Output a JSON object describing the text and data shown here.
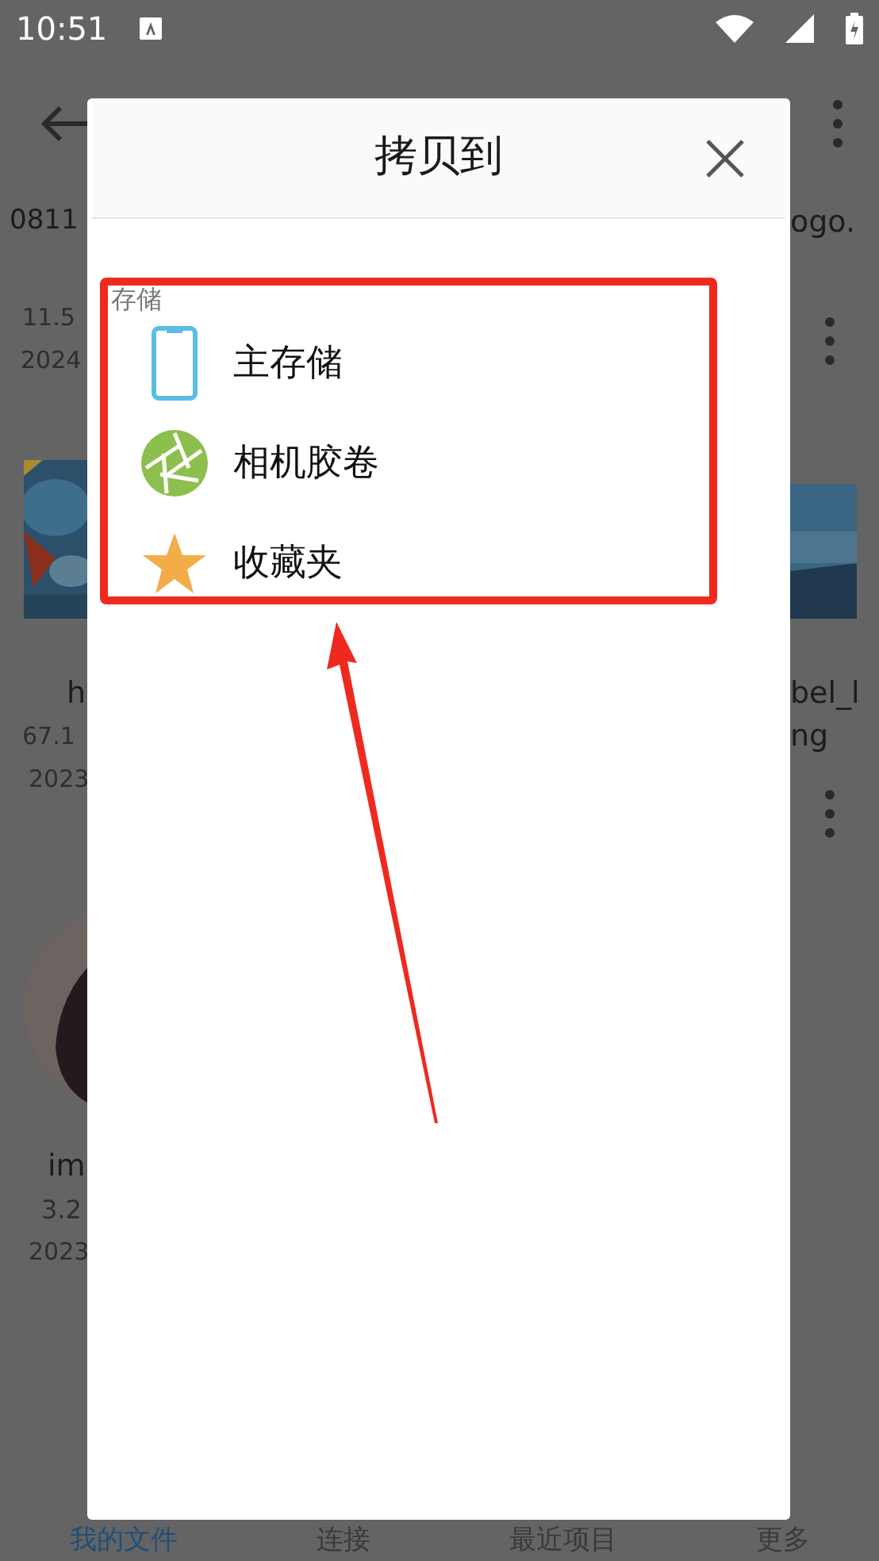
{
  "status_bar": {
    "time": "10:51"
  },
  "files": [
    {
      "name": "0811",
      "size": "11.5",
      "date": "2024"
    },
    {
      "name": "h",
      "size": "67.1",
      "date": "2023"
    },
    {
      "name": "im",
      "size": "3.2",
      "date": "2023"
    }
  ],
  "right_edge": {
    "row_name": "ogo.",
    "tile_name_lines": [
      "bel_l",
      "ng"
    ]
  },
  "dialog": {
    "title": "拷贝到",
    "section": "存储",
    "items": [
      {
        "label": "主存储",
        "kind": "phone"
      },
      {
        "label": "相机胶卷",
        "kind": "camera"
      },
      {
        "label": "收藏夹",
        "kind": "star"
      }
    ]
  },
  "bottom_nav": [
    {
      "label": "我的文件",
      "selected": true
    },
    {
      "label": "连接",
      "selected": false
    },
    {
      "label": "最近项目",
      "selected": false
    },
    {
      "label": "更多",
      "selected": false
    }
  ]
}
